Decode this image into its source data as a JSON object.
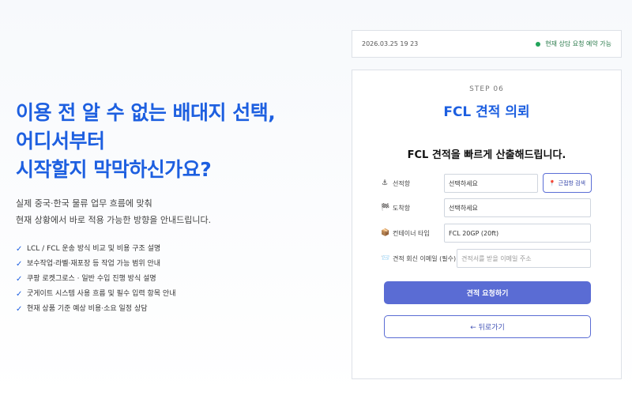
{
  "hero": {
    "title_lines": [
      "이용 전 알 수 없는 배대지 선택,",
      "어디서부터",
      "시작할지 막막하신가요?"
    ],
    "desc_lines": [
      "실제 중국·한국 물류 업무 흐름에 맞춰",
      "현재 상황에서 바로 적용 가능한 방향을 안내드립니다."
    ],
    "check_mark": "✓",
    "checks": [
      "LCL / FCL 운송 방식 비교 및 비용 구조 설명",
      "보수작업·라벨·재포장 등 작업 가능 범위 안내",
      "쿠팡 로켓그로스 · 일반 수입 진행 방식 설명",
      "굿게이트 시스템 사용 흐름 및 필수 입력 항목 안내",
      "현재 상품 기준 예상 비용·소요 일정 상담"
    ]
  },
  "status": {
    "datetime": "2026.03.25 19 23",
    "availability": "현재 상담 요청 예약 가능",
    "dot_color": "#22a45a"
  },
  "form": {
    "step": "STEP 06",
    "title": "FCL 견적 의뢰",
    "subtitle": "FCL 견적을 빠르게 산출해드립니다.",
    "fields": {
      "origin": {
        "icon": "anchor-icon",
        "glyph": "⚓",
        "label": "선적항",
        "value": "선택하세요"
      },
      "destination": {
        "icon": "flag-icon",
        "glyph": "🏁",
        "label": "도착항",
        "value": "선택하세요"
      },
      "container": {
        "icon": "box-icon",
        "glyph": "📦",
        "label": "컨테이너 타입",
        "value": "FCL 20GP (20ft)"
      },
      "email": {
        "icon": "mail-icon",
        "glyph": "📨",
        "label": "견적 회신 이메일 (필수)",
        "placeholder": "견적서를 받을 이메일 주소"
      }
    },
    "nearby_button": "근접항 검색",
    "nearby_glyph": "📍",
    "submit_label": "견적 요청하기",
    "back_label": "← 뒤로가기"
  },
  "colors": {
    "accent": "#1d5fe0",
    "button": "#5a6cd4"
  }
}
